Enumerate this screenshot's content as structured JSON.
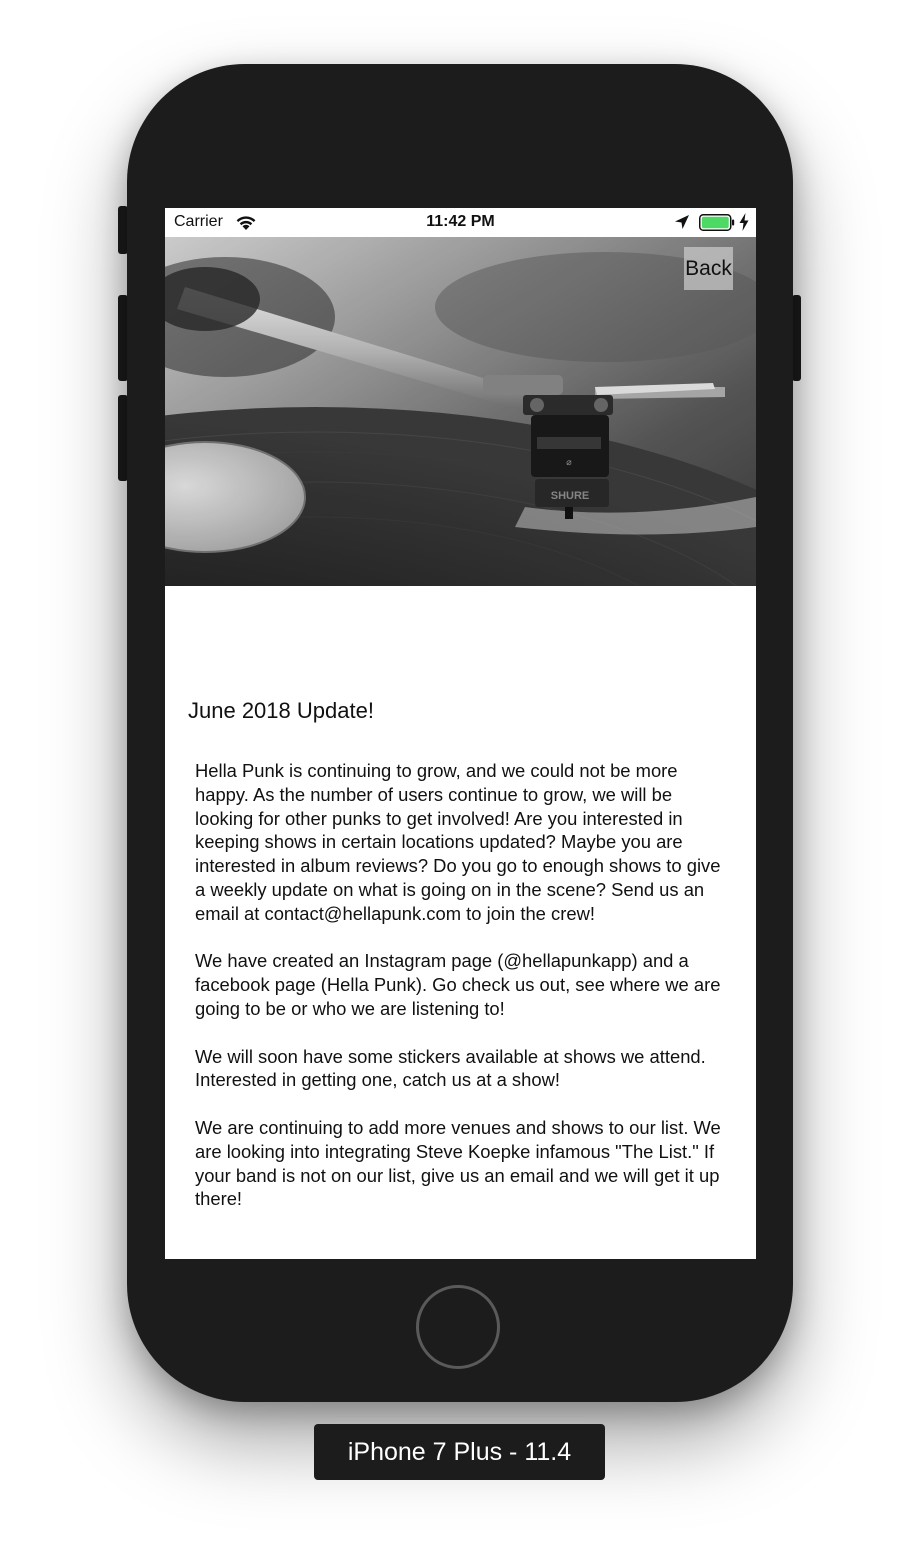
{
  "status_bar": {
    "carrier": "Carrier",
    "time": "11:42 PM",
    "icons": [
      "wifi-icon",
      "location-arrow-icon",
      "battery-icon",
      "charging-bolt-icon"
    ],
    "battery_color": "#4cd964"
  },
  "hero": {
    "image_subject": "turntable-tonearm-on-vinyl-record",
    "cartridge_brand_text": "SHURE"
  },
  "back_button": {
    "label": "Back"
  },
  "post": {
    "title": "June 2018 Update!",
    "paragraphs": [
      "Hella Punk is continuing to grow, and we could not be more happy. As the number of users continue to grow, we will be looking for other punks to get involved! Are you interested in keeping shows in certain locations updated? Maybe you are interested in album reviews? Do you go to enough shows to give a weekly update on what is going on in the scene? Send us an email at contact@hellapunk.com to join the crew!",
      "We have created an Instagram page (@hellapunkapp) and a facebook page (Hella Punk). Go check us out, see where we are going to be or who we are listening to!",
      "We will soon have some stickers available at shows we attend. Interested in getting one, catch us at a show!",
      "We are continuing to add more venues and shows to our list. We are looking into integrating Steve Koepke infamous \"The List.\" If your band is not on our list, give us an email and we will get it up there!"
    ]
  },
  "device": {
    "label": "iPhone 7 Plus - 11.4",
    "frame_color": "#1c1c1c"
  }
}
